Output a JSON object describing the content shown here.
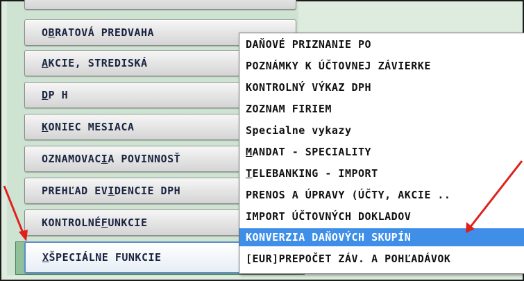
{
  "left_menu": {
    "top_stub_label": "",
    "items": [
      {
        "pre": "O",
        "u": "B",
        "post": "RATOVÁ PREDVAHA"
      },
      {
        "pre": "",
        "u": "A",
        "post": "KCIE, STREDISKÁ"
      },
      {
        "pre": "",
        "u": "D",
        "post": " P H"
      },
      {
        "pre": "",
        "u": "K",
        "post": "ONIEC MESIACA"
      },
      {
        "pre": "OZNAMOVAC",
        "u": "I",
        "post": "A POVINNOSŤ"
      },
      {
        "pre": "PREHĽAD EV",
        "u": "I",
        "post": "DENCIE DPH"
      },
      {
        "pre": "KONTROLNÉ ",
        "u": "F",
        "post": "UNKCIE"
      }
    ],
    "selected": {
      "pre": "",
      "u": "X",
      "post": " ŠPECIÁLNE FUNKCIE"
    }
  },
  "popup_menu": {
    "items": [
      {
        "pre": "DAŇOVÉ PRIZNANIE PO",
        "u": "",
        "post": ""
      },
      {
        "pre": "POZNÁMKY K ÚČTOVNEJ ZÁVIERKE",
        "u": "",
        "post": ""
      },
      {
        "pre": "KONTROLNÝ VÝKAZ DPH",
        "u": "",
        "post": ""
      },
      {
        "pre": "ZOZNAM FIRIEM",
        "u": "",
        "post": ""
      },
      {
        "pre": "Specialne vykazy",
        "u": "",
        "post": ""
      },
      {
        "pre": "",
        "u": "M",
        "post": "ANDAT - SPECIALITY"
      },
      {
        "pre": "",
        "u": "T",
        "post": "ELEBANKING - IMPORT"
      },
      {
        "pre": "PRENOS A ÚPRAVY (ÚČTY, AKCIE ..",
        "u": "",
        "post": ""
      },
      {
        "pre": "IMPORT ÚČTOVNÝCH  DOKLADOV",
        "u": "",
        "post": ""
      },
      {
        "pre": "KONVERZIA DAŇOVÝCH SKUPÍN",
        "u": "",
        "post": ""
      },
      {
        "pre": "[EUR]PREPOČET ZÁV. A POHĽADÁVOK",
        "u": "",
        "post": ""
      }
    ],
    "highlighted_index": 9
  },
  "colors": {
    "highlight": "#3f8fe8",
    "arrow": "#e0201b",
    "selected_bg": "#8fc09a"
  }
}
